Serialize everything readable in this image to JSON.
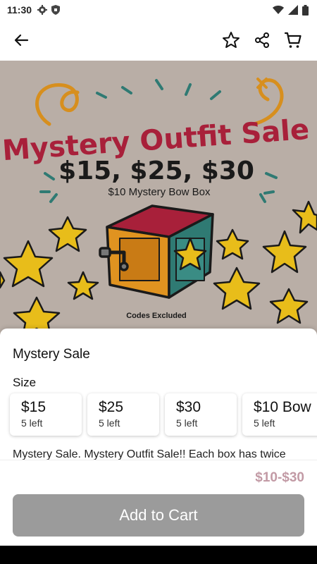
{
  "status_bar": {
    "time": "11:30",
    "icons": [
      "gear-icon",
      "shield-icon",
      "wifi-icon",
      "signal-icon",
      "battery-icon"
    ]
  },
  "app_bar": {
    "icons": [
      "back-arrow-icon",
      "star-outline-icon",
      "share-icon",
      "cart-icon"
    ]
  },
  "hero": {
    "headline": "Mystery Outfit Sale",
    "prices": "$15, $25, $30",
    "subline": "$10 Mystery Bow Box",
    "footnote": "Codes Excluded",
    "colors": {
      "background": "#b9aea6",
      "headline": "#a8203a",
      "prices": "#1a1a1a",
      "star": "#e8bd1a",
      "box_orange": "#e09320",
      "box_teal": "#2f7a73"
    }
  },
  "product": {
    "title": "Mystery Sale",
    "size_label": "Size",
    "sizes": [
      {
        "price": "$15",
        "stock": "5 left"
      },
      {
        "price": "$25",
        "stock": "5 left"
      },
      {
        "price": "$30",
        "stock": "5 left"
      },
      {
        "price": "$10 Bow",
        "stock": "5 left"
      }
    ],
    "description": "Mystery Sale. Mystery Outfit Sale!! Each box has twice"
  },
  "footer": {
    "price_range": "$10-$30",
    "add_to_cart": "Add to Cart",
    "colors": {
      "price_range": "#c29aa5",
      "button": "#9b9b9b"
    }
  }
}
